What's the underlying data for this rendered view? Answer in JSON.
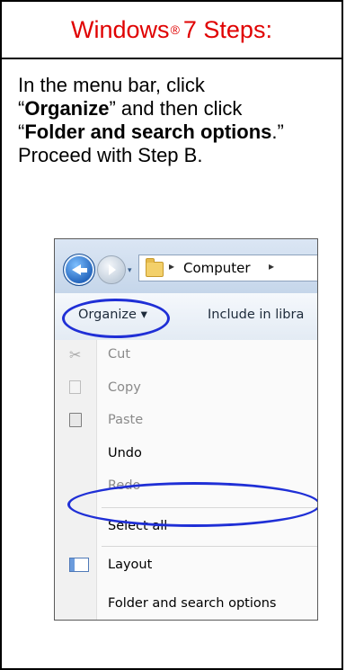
{
  "title": {
    "text": "Windows",
    "reg": "®",
    "suffix": "7 Steps:"
  },
  "instructions": {
    "line1": "In the menu bar, click",
    "quote_open1": "“",
    "organize": "Organize",
    "quote_close1": "” and then click",
    "quote_open2": "“",
    "folder_options": "Folder and search options",
    "quote_close2": ".”  Proceed with Step B."
  },
  "screenshot": {
    "path_label": "Computer",
    "path_separator": "▸",
    "dropdown_glyph": "▾",
    "organize_label": "Organize ▾",
    "include_label": "Include in libra",
    "menu_items": [
      {
        "label": "Cut",
        "disabled": true
      },
      {
        "label": "Copy",
        "disabled": true
      },
      {
        "label": "Paste",
        "disabled": true
      },
      {
        "label": "Undo",
        "disabled": false
      },
      {
        "label": "Redo",
        "disabled": true
      },
      {
        "label": "Select all",
        "disabled": false
      },
      {
        "label": "Layout",
        "disabled": false
      },
      {
        "label": "Folder and search options",
        "disabled": false
      }
    ],
    "highlight_color": "#1f2fd6"
  },
  "colors": {
    "title_red": "#e00000"
  }
}
